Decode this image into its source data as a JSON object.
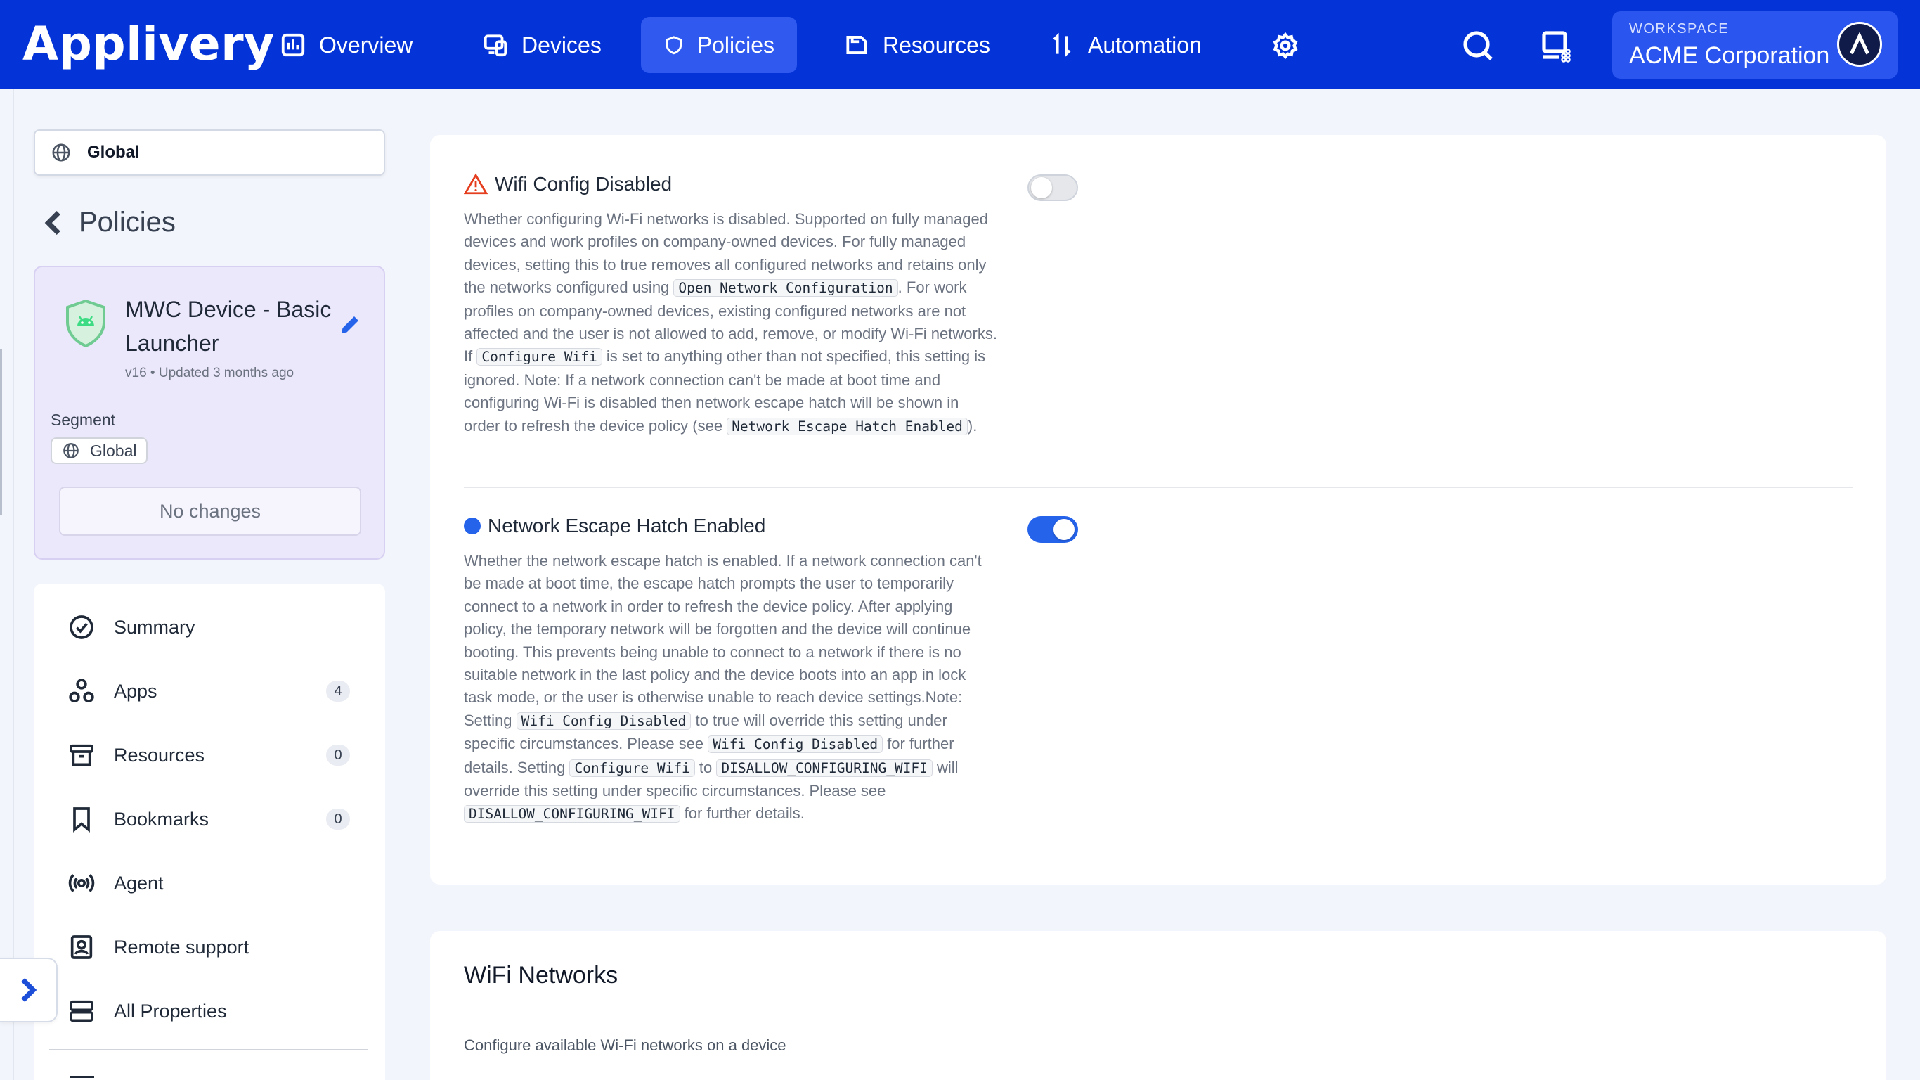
{
  "brand": {
    "logo_text": "Applivery"
  },
  "nav": {
    "items": [
      {
        "label": "Overview",
        "icon": "chart-bars-icon"
      },
      {
        "label": "Devices",
        "icon": "devices-icon"
      },
      {
        "label": "Policies",
        "icon": "shield-icon",
        "active": true
      },
      {
        "label": "Resources",
        "icon": "folder-icon"
      },
      {
        "label": "Automation",
        "icon": "arrows-icon"
      }
    ],
    "settings_icon": "gear-icon",
    "search_icon": "search-icon",
    "apps_icon": "device-grid-icon",
    "workspace": {
      "caption": "WORKSPACE",
      "name": "ACME Corporation"
    }
  },
  "sidebar": {
    "segment_select": "Global",
    "back_label": "Policies",
    "policy": {
      "name": "MWC Device - Basic Launcher",
      "meta": "v16 • Updated 3 months ago",
      "segment_label": "Segment",
      "segment_value": "Global",
      "status_button": "No changes"
    },
    "menu": [
      {
        "label": "Summary",
        "icon": "check-circle-icon",
        "count": null
      },
      {
        "label": "Apps",
        "icon": "apps-icon",
        "count": "4"
      },
      {
        "label": "Resources",
        "icon": "archive-icon",
        "count": "0"
      },
      {
        "label": "Bookmarks",
        "icon": "bookmark-icon",
        "count": "0"
      },
      {
        "label": "Agent",
        "icon": "broadcast-icon",
        "count": null
      },
      {
        "label": "Remote support",
        "icon": "remote-support-icon",
        "count": null
      },
      {
        "label": "All Properties",
        "icon": "list-icon",
        "count": null
      }
    ]
  },
  "settings": {
    "wifi_config": {
      "title": "Wifi Config Disabled",
      "enabled": false,
      "desc": [
        {
          "t": "text",
          "v": "Whether configuring Wi-Fi networks is disabled. Supported on fully managed devices and work profiles on company-owned devices. For fully managed devices, setting this to true removes all configured networks and retains only the networks configured using "
        },
        {
          "t": "code",
          "v": "Open Network Configuration"
        },
        {
          "t": "text",
          "v": ". For work profiles on company-owned devices, existing configured networks are not affected and the user is not allowed to add, remove, or modify Wi-Fi networks. If "
        },
        {
          "t": "code",
          "v": "Configure Wifi"
        },
        {
          "t": "text",
          "v": " is set to anything other than not specified, this setting is ignored. Note: If a network connection can't be made at boot time and configuring Wi-Fi is disabled then network escape hatch will be shown in order to refresh the device policy (see "
        },
        {
          "t": "code",
          "v": "Network Escape Hatch Enabled"
        },
        {
          "t": "text",
          "v": ")."
        }
      ]
    },
    "escape_hatch": {
      "title": "Network Escape Hatch Enabled",
      "enabled": true,
      "desc": [
        {
          "t": "text",
          "v": "Whether the network escape hatch is enabled. If a network connection can't be made at boot time, the escape hatch prompts the user to temporarily connect to a network in order to refresh the device policy. After applying policy, the temporary network will be forgotten and the device will continue booting. This prevents being unable to connect to a network if there is no suitable network in the last policy and the device boots into an app in lock task mode, or the user is otherwise unable to reach device settings.Note: Setting "
        },
        {
          "t": "code",
          "v": "Wifi Config Disabled"
        },
        {
          "t": "text",
          "v": " to true will override this setting under specific circumstances. Please see "
        },
        {
          "t": "code",
          "v": "Wifi Config Disabled"
        },
        {
          "t": "text",
          "v": " for further details. Setting "
        },
        {
          "t": "code",
          "v": "Configure Wifi"
        },
        {
          "t": "text",
          "v": " to "
        },
        {
          "t": "code",
          "v": "DISALLOW_CONFIGURING_WIFI"
        },
        {
          "t": "text",
          "v": " will override this setting under specific circumstances. Please see "
        },
        {
          "t": "code",
          "v": "DISALLOW_CONFIGURING_WIFI"
        },
        {
          "t": "text",
          "v": " for further details."
        }
      ]
    }
  },
  "wifi_networks": {
    "title": "WiFi Networks",
    "subtitle": "Configure available Wi-Fi networks on a device"
  },
  "colors": {
    "nav_bg": "#0434d8",
    "nav_active": "#2f59ef",
    "accent": "#2563eb",
    "policy_card_bg": "#ece8fb",
    "warning": "#e53e1f"
  }
}
